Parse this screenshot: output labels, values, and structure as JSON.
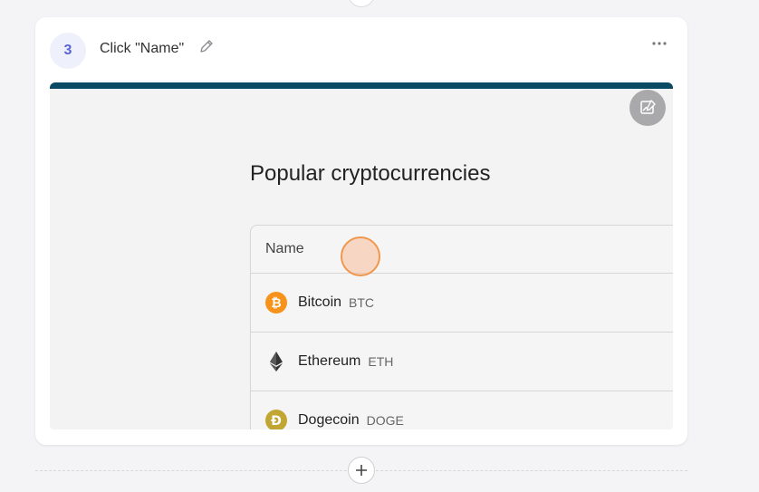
{
  "step": {
    "number": "3",
    "title": "Click \"Name\""
  },
  "screenshot": {
    "heading": "Popular cryptocurrencies",
    "table": {
      "column_header": "Name",
      "rows": [
        {
          "name": "Bitcoin",
          "symbol": "BTC",
          "icon": "bitcoin-icon",
          "color": "#f7931a"
        },
        {
          "name": "Ethereum",
          "symbol": "ETH",
          "icon": "ethereum-icon",
          "color": "#343434"
        },
        {
          "name": "Dogecoin",
          "symbol": "DOGE",
          "icon": "dogecoin-icon",
          "color": "#c2a633"
        }
      ]
    }
  },
  "colors": {
    "badge_bg": "#eef0fb",
    "badge_text": "#5b63d3",
    "screenshot_topbar": "#0b4a63",
    "click_marker": "#f0974e"
  }
}
